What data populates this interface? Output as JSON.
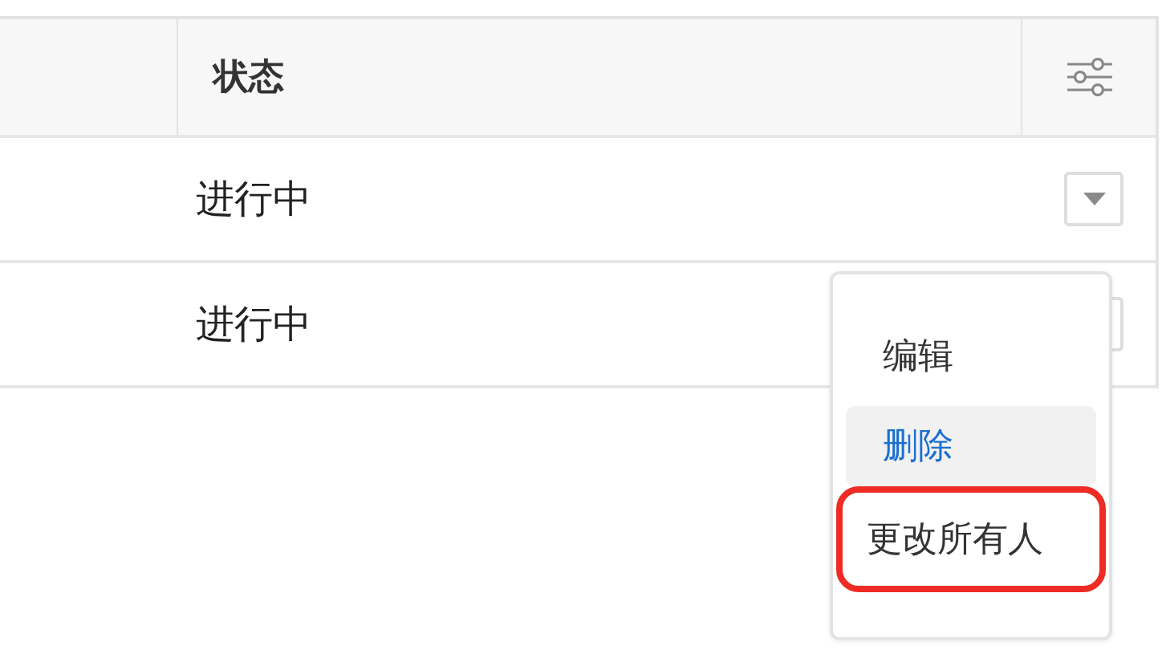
{
  "table": {
    "columns": [
      {
        "label": "状态"
      }
    ],
    "rows": [
      {
        "status": "进行中",
        "menu_open": false
      },
      {
        "status": "进行中",
        "menu_open": true
      }
    ]
  },
  "menu": {
    "items": [
      {
        "label": "编辑",
        "selected": false,
        "highlighted": false
      },
      {
        "label": "删除",
        "selected": true,
        "highlighted": false
      },
      {
        "label": "更改所有人",
        "selected": false,
        "highlighted": true
      }
    ]
  }
}
